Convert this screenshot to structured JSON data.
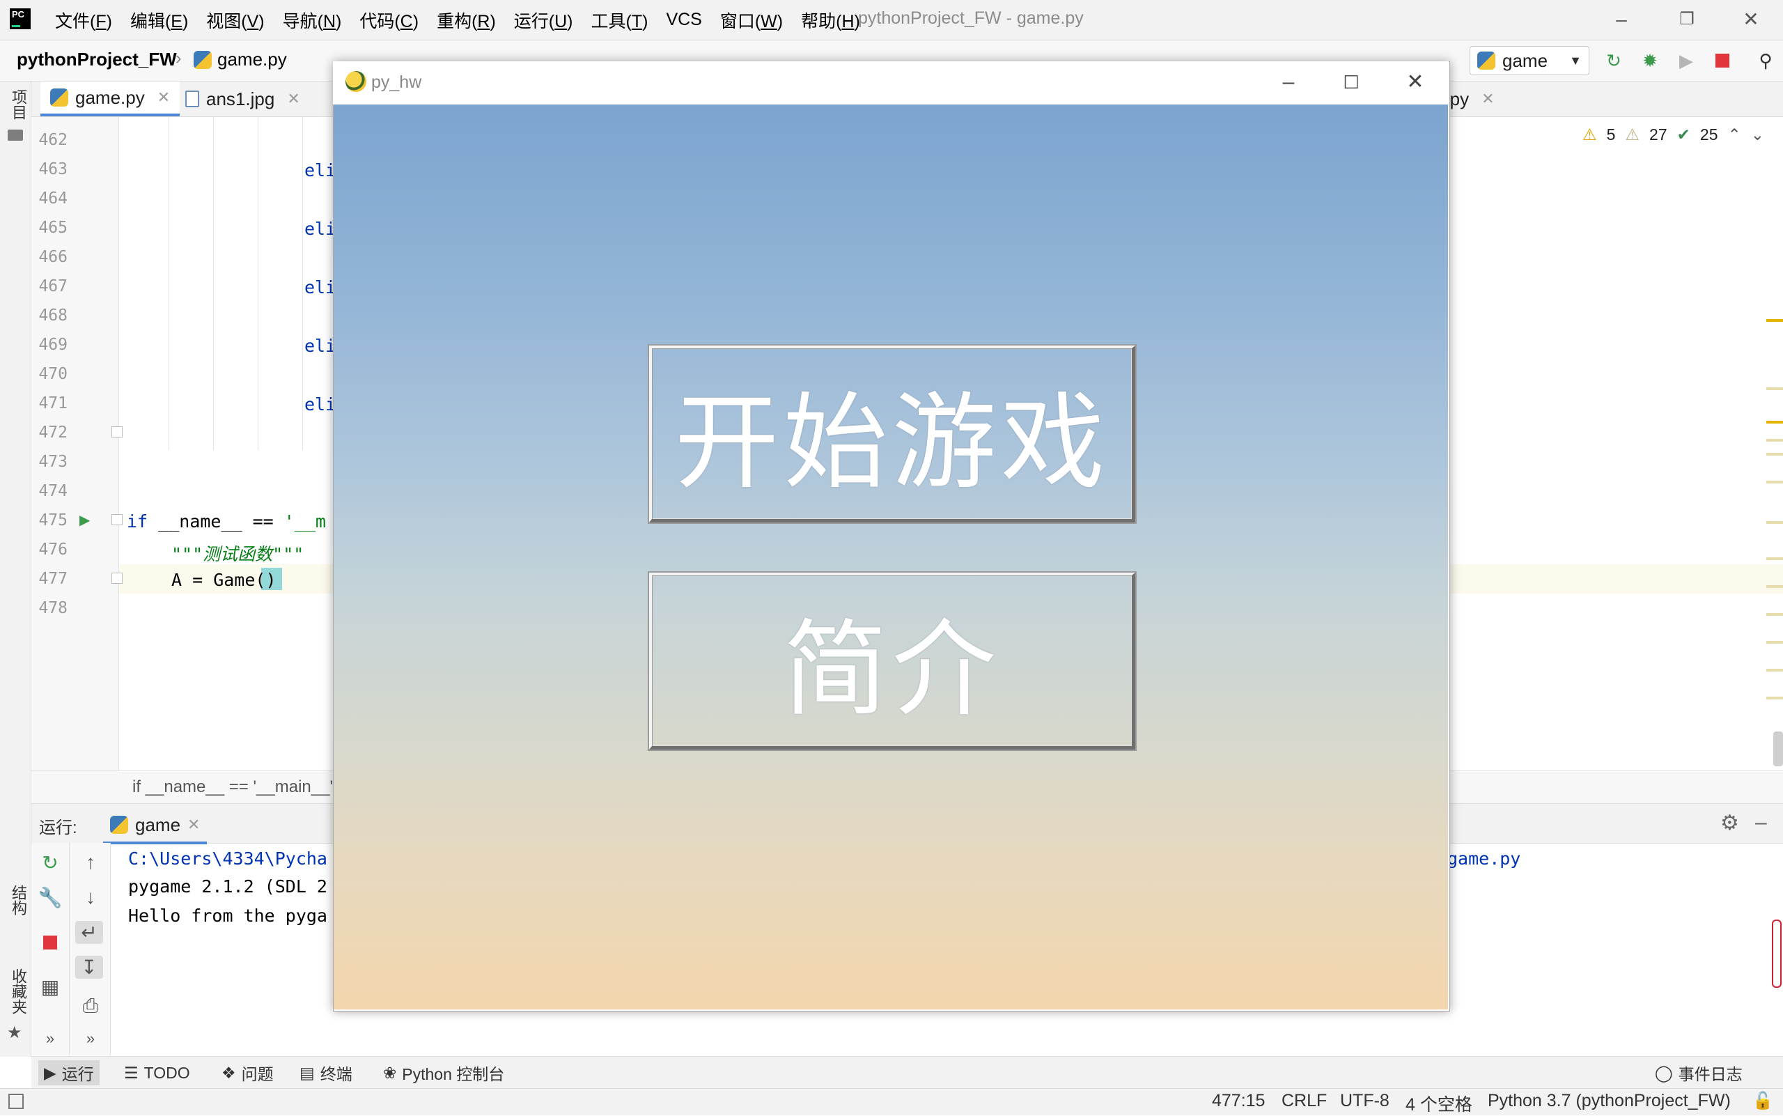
{
  "menubar": {
    "logo_text": "PC",
    "items": [
      {
        "label": "文件(",
        "key": "F",
        "end": ")"
      },
      {
        "label": "编辑(",
        "key": "E",
        "end": ")"
      },
      {
        "label": "视图(",
        "key": "V",
        "end": ")"
      },
      {
        "label": "导航(",
        "key": "N",
        "end": ")"
      },
      {
        "label": "代码(",
        "key": "C",
        "end": ")"
      },
      {
        "label": "重构(",
        "key": "R",
        "end": ")"
      },
      {
        "label": "运行(",
        "key": "U",
        "end": ")"
      },
      {
        "label": "工具(",
        "key": "T",
        "end": ")"
      },
      {
        "label": "VCS",
        "key": "",
        "end": ""
      },
      {
        "label": "窗口(",
        "key": "W",
        "end": ")"
      },
      {
        "label": "帮助(",
        "key": "H",
        "end": ")"
      }
    ],
    "window_title": "pythonProject_FW - game.py"
  },
  "navbar": {
    "project": "pythonProject_FW",
    "file": "game.py",
    "run_config": "game"
  },
  "left_strip": {
    "project_label": "项目",
    "structure_label": "结构",
    "favorites_label": "收藏夹"
  },
  "tabs": [
    {
      "label": "game.py"
    },
    {
      "label": "ans1.jpg"
    },
    {
      "label": "g.py"
    }
  ],
  "editor": {
    "line_numbers": [
      "462",
      "463",
      "464",
      "465",
      "466",
      "467",
      "468",
      "469",
      "470",
      "471",
      "472",
      "473",
      "474",
      "475",
      "476",
      "477",
      "478"
    ],
    "code": {
      "l463": "eli",
      "l465": "eli",
      "l467": "eli",
      "l469": "eli",
      "l471": "eli",
      "l475_kw": "if",
      "l475_rest": " __name__ == ",
      "l475_str": "'__m",
      "l476": "\"\"\"测试函数\"\"\"",
      "l477_a": "A = Game(",
      "l477_b": ")"
    },
    "footer_breadcrumb": "if __name__ == '__main__'",
    "inspections": {
      "warnings": "5",
      "weak_warnings": "27",
      "typos": "25"
    }
  },
  "run_panel": {
    "label": "运行:",
    "tab": "game",
    "console": [
      "C:\\Users\\4334\\Pycha",
      "pygame 2.1.2 (SDL 2",
      "Hello from the pyga"
    ],
    "console_path_tail": "game.py"
  },
  "bottom_tools": [
    {
      "label": "运行"
    },
    {
      "label": "TODO"
    },
    {
      "label": "问题"
    },
    {
      "label": "终端"
    },
    {
      "label": "Python 控制台"
    }
  ],
  "event_log": "事件日志",
  "status": {
    "position": "477:15",
    "line_sep": "CRLF",
    "encoding": "UTF-8",
    "indent": "4 个空格",
    "interpreter": "Python 3.7 (pythonProject_FW)"
  },
  "pygame_window": {
    "title": "py_hw",
    "start_button": "开始游戏",
    "intro_button": "简介"
  },
  "colors": {
    "accent": "#4a87d6",
    "sky_top": "#7ca4cf",
    "sky_bottom": "#f3d6ad"
  }
}
